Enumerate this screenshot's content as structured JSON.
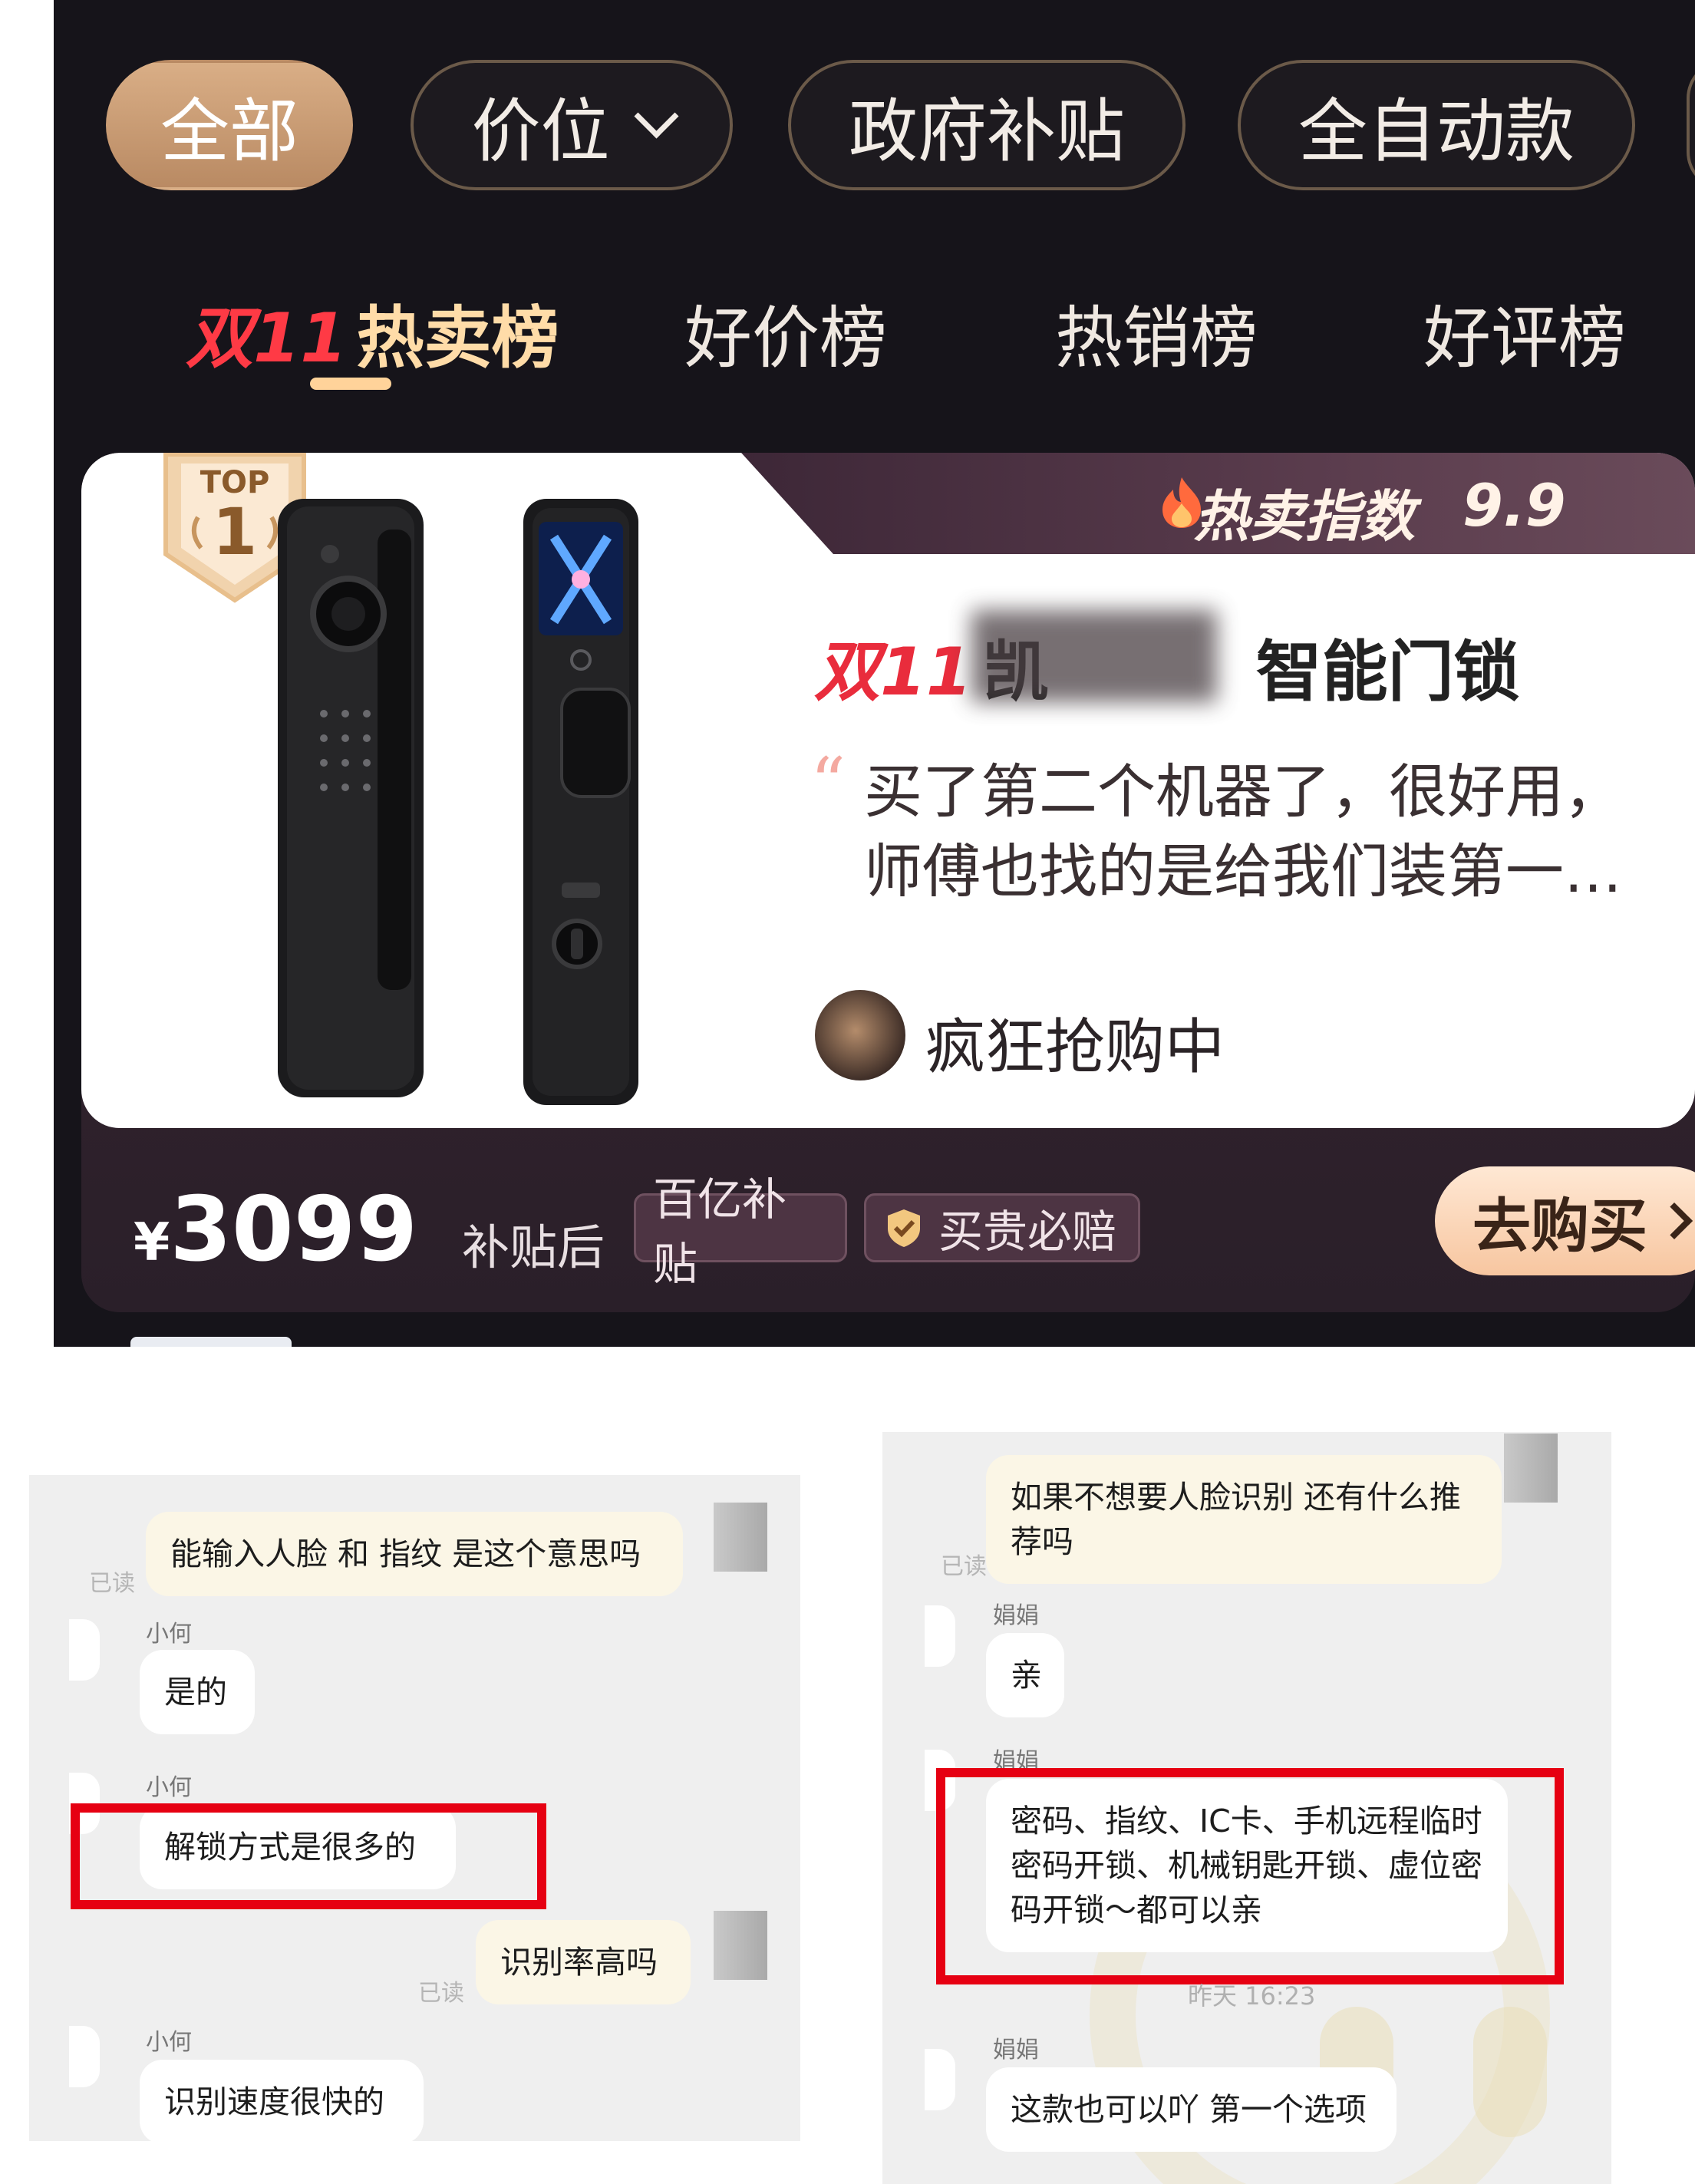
{
  "filters": {
    "all": "全部",
    "price": "价位",
    "subsidy": "政府补贴",
    "automatic": "全自动款"
  },
  "ranking_tabs": {
    "double11_prefix": "双11",
    "hot_sale": "热卖榜",
    "good_price": "好价榜",
    "best_selling": "热销榜",
    "good_review": "好评榜"
  },
  "product": {
    "badge_top": "TOP",
    "badge_rank": "1",
    "heat_label": "热卖指数",
    "heat_value": "9.9",
    "title_prefix": "双11",
    "title_visible_start": "凯",
    "title_visible_end": "智能门锁",
    "quote_mark": "“",
    "review": "买了第二个机器了，很好用，师傅也找的是给我们装第一…",
    "status": "疯狂抢购中",
    "currency": "¥",
    "price": "3099",
    "price_note": "补贴后",
    "tag_subsidy": "百亿补贴",
    "tag_guarantee": "买贵必赔",
    "buy_label": "去购买",
    "colors": {
      "accent_red": "#e92c3c",
      "tab_active": "#ffdca8",
      "buy_button": "#f7c6a0"
    }
  },
  "chat_left": {
    "read_label_partial": "已读",
    "read_label": "已读",
    "messages": [
      {
        "from": "me",
        "text": "能输入人脸 和 指纹 是这个意思吗"
      },
      {
        "from": "小何",
        "text": "是的"
      },
      {
        "from": "小何",
        "text": "解锁方式是很多的"
      },
      {
        "from": "me",
        "text": "识别率高吗"
      },
      {
        "from": "小何",
        "text": "识别速度很快的"
      }
    ]
  },
  "chat_right": {
    "read_label_partial": "已读",
    "timestamp": "昨天 16:23",
    "messages": [
      {
        "from": "me",
        "text": "如果不想要人脸识别 还有什么推荐吗"
      },
      {
        "from": "娟娟",
        "text": "亲"
      },
      {
        "from": "娟娟",
        "text": "密码、指纹、IC卡、手机远程临时密码开锁、机械钥匙开锁、虚位密码开锁～都可以亲"
      },
      {
        "from": "娟娟",
        "text": "这款也可以吖  第一个选项"
      }
    ]
  }
}
